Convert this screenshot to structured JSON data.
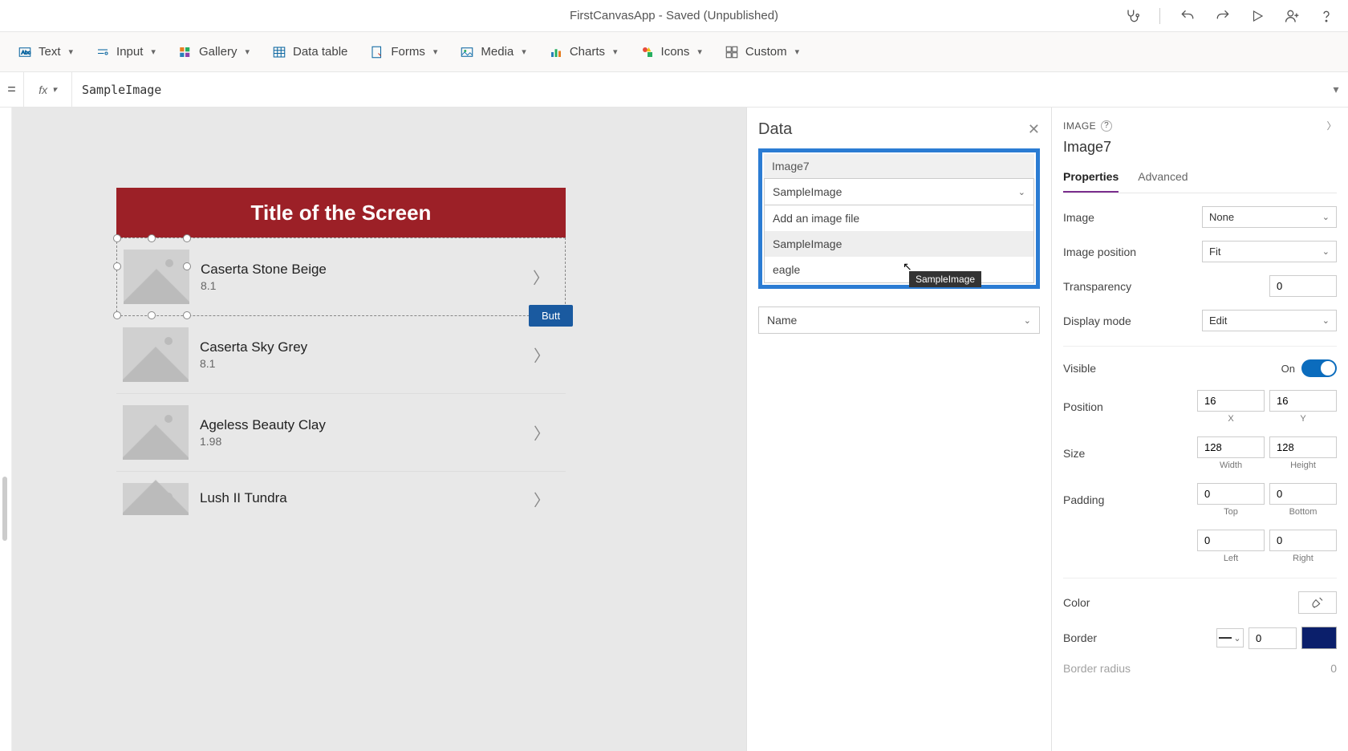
{
  "titleBar": {
    "titleText": "FirstCanvasApp - Saved (Unpublished)"
  },
  "ribbon": {
    "items": [
      {
        "label": "Text"
      },
      {
        "label": "Input"
      },
      {
        "label": "Gallery"
      },
      {
        "label": "Data table"
      },
      {
        "label": "Forms"
      },
      {
        "label": "Media"
      },
      {
        "label": "Charts"
      },
      {
        "label": "Icons"
      },
      {
        "label": "Custom"
      }
    ]
  },
  "formula": {
    "eq": "=",
    "fx": "fx",
    "value": "SampleImage"
  },
  "canvas": {
    "screenTitle": "Title of the Screen",
    "buttonLabel": "Butt",
    "gallery": [
      {
        "title": "Caserta Stone Beige",
        "sub": "8.1"
      },
      {
        "title": "Caserta Sky Grey",
        "sub": "8.1"
      },
      {
        "title": "Ageless Beauty Clay",
        "sub": "1.98"
      },
      {
        "title": "Lush II Tundra",
        "sub": ""
      }
    ]
  },
  "dataPanel": {
    "title": "Data",
    "controlName": "Image7",
    "selectedValue": "SampleImage",
    "dropdownOptions": [
      "Add an image file",
      "SampleImage",
      "eagle"
    ],
    "tooltip": "SampleImage",
    "nameField": "Name"
  },
  "propsPanel": {
    "headerType": "IMAGE",
    "controlName": "Image7",
    "tabs": {
      "properties": "Properties",
      "advanced": "Advanced"
    },
    "image": {
      "label": "Image",
      "value": "None"
    },
    "imagePosition": {
      "label": "Image position",
      "value": "Fit"
    },
    "transparency": {
      "label": "Transparency",
      "value": "0"
    },
    "displayMode": {
      "label": "Display mode",
      "value": "Edit"
    },
    "visible": {
      "label": "Visible",
      "onText": "On"
    },
    "position": {
      "label": "Position",
      "x": "16",
      "y": "16",
      "xLabel": "X",
      "yLabel": "Y"
    },
    "size": {
      "label": "Size",
      "w": "128",
      "h": "128",
      "wLabel": "Width",
      "hLabel": "Height"
    },
    "padding": {
      "label": "Padding",
      "top": "0",
      "bottom": "0",
      "left": "0",
      "right": "0",
      "topLabel": "Top",
      "bottomLabel": "Bottom",
      "leftLabel": "Left",
      "rightLabel": "Right"
    },
    "color": {
      "label": "Color"
    },
    "border": {
      "label": "Border",
      "width": "0"
    },
    "borderRadius": {
      "label": "Border radius",
      "value": "0"
    }
  }
}
